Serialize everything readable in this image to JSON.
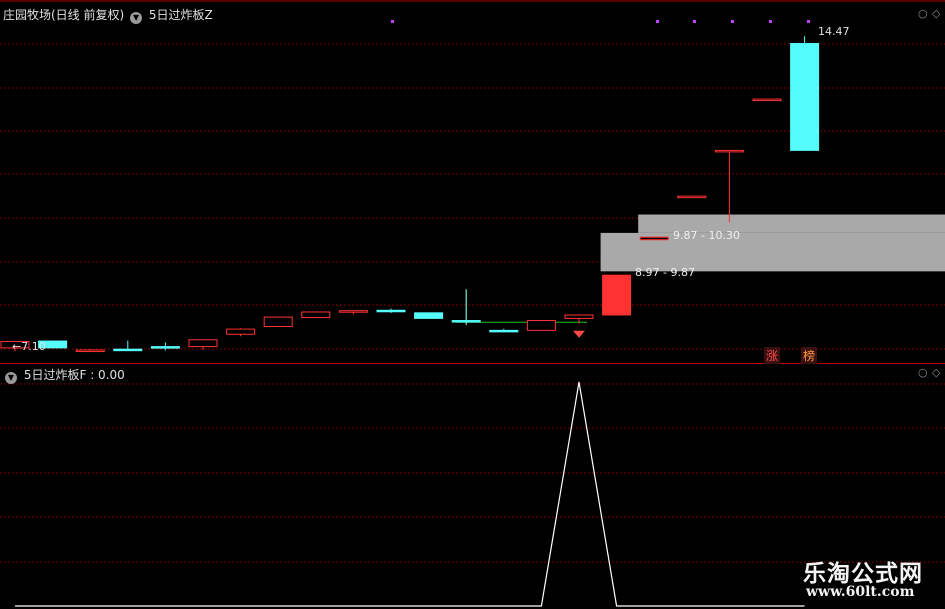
{
  "header": {
    "title": "庄园牧场(日线 前复权)",
    "indicator": "5日过炸板Z"
  },
  "sub_header": {
    "label": "5日过炸板F",
    "value": ": 0.00"
  },
  "price_labels": {
    "low": "←7.10",
    "high": "14.47",
    "zone_upper": "9.87 - 10.30",
    "zone_lower": "8.97 - 9.87"
  },
  "badges": [
    "涨",
    "榜"
  ],
  "watermark": {
    "line1": "乐淘公式网",
    "line2": "www.60lt.com"
  },
  "colors": {
    "up": "#ff3232",
    "down": "#54fcfc",
    "zone": "#a9a9a9",
    "grid": "#7a0000",
    "sub_line": "#ffffff"
  },
  "chart_data": [
    {
      "type": "candlestick",
      "title": "庄园牧场(日线 前复权)",
      "candles": [
        {
          "o": 7.18,
          "h": 7.32,
          "l": 7.1,
          "c": 7.33,
          "dir": "up"
        },
        {
          "o": 7.34,
          "h": 7.34,
          "l": 7.18,
          "c": 7.18,
          "dir": "down"
        },
        {
          "o": 7.1,
          "h": 7.16,
          "l": 7.08,
          "c": 7.13,
          "dir": "up"
        },
        {
          "o": 7.15,
          "h": 7.35,
          "l": 7.15,
          "c": 7.15,
          "dir": "down"
        },
        {
          "o": 7.21,
          "h": 7.31,
          "l": 7.12,
          "c": 7.21,
          "dir": "down"
        },
        {
          "o": 7.21,
          "h": 7.36,
          "l": 7.13,
          "c": 7.37,
          "dir": "up"
        },
        {
          "o": 7.5,
          "h": 7.64,
          "l": 7.45,
          "c": 7.62,
          "dir": "up"
        },
        {
          "o": 7.68,
          "h": 7.9,
          "l": 7.68,
          "c": 7.9,
          "dir": "up"
        },
        {
          "o": 7.89,
          "h": 8.02,
          "l": 7.89,
          "c": 8.02,
          "dir": "up"
        },
        {
          "o": 8.03,
          "h": 8.04,
          "l": 7.96,
          "c": 8.05,
          "dir": "up"
        },
        {
          "o": 8.06,
          "h": 8.1,
          "l": 8.0,
          "c": 8.03,
          "dir": "down"
        },
        {
          "o": 8.0,
          "h": 8.0,
          "l": 7.87,
          "c": 7.87,
          "dir": "down"
        },
        {
          "o": 7.82,
          "h": 8.55,
          "l": 7.72,
          "c": 7.79,
          "dir": "down"
        },
        {
          "o": 7.59,
          "h": 7.63,
          "l": 7.56,
          "c": 7.59,
          "dir": "down"
        },
        {
          "o": 7.59,
          "h": 7.82,
          "l": 7.59,
          "c": 7.82,
          "dir": "up"
        },
        {
          "o": 7.87,
          "h": 7.95,
          "l": 7.75,
          "c": 7.95,
          "dir": "up"
        },
        {
          "o": 7.95,
          "h": 8.88,
          "l": 7.95,
          "c": 8.88,
          "dir": "up"
        },
        {
          "o": 9.71,
          "h": 9.77,
          "l": 9.71,
          "c": 9.77,
          "dir": "up"
        },
        {
          "o": 10.72,
          "h": 10.72,
          "l": 10.72,
          "c": 10.73,
          "dir": "up"
        },
        {
          "o": 11.8,
          "h": 11.8,
          "l": 10.12,
          "c": 11.8,
          "dir": "up"
        },
        {
          "o": 12.99,
          "h": 12.99,
          "l": 12.99,
          "c": 13.0,
          "dir": "up"
        },
        {
          "o": 14.3,
          "h": 14.47,
          "l": 11.8,
          "c": 11.8,
          "dir": "down"
        }
      ],
      "zones": [
        {
          "low": 9.87,
          "high": 10.3,
          "start": 17
        },
        {
          "low": 8.97,
          "high": 9.87,
          "start": 16
        }
      ],
      "ylim": [
        6.85,
        14.85
      ]
    },
    {
      "type": "line",
      "series": [
        {
          "name": "5日过炸板F",
          "values": [
            0,
            0,
            0,
            0,
            0,
            0,
            0,
            0,
            0,
            0,
            0,
            0,
            0,
            0,
            0,
            1,
            0,
            0,
            0,
            0,
            0,
            0
          ]
        }
      ],
      "ylim": [
        0,
        1
      ]
    }
  ]
}
